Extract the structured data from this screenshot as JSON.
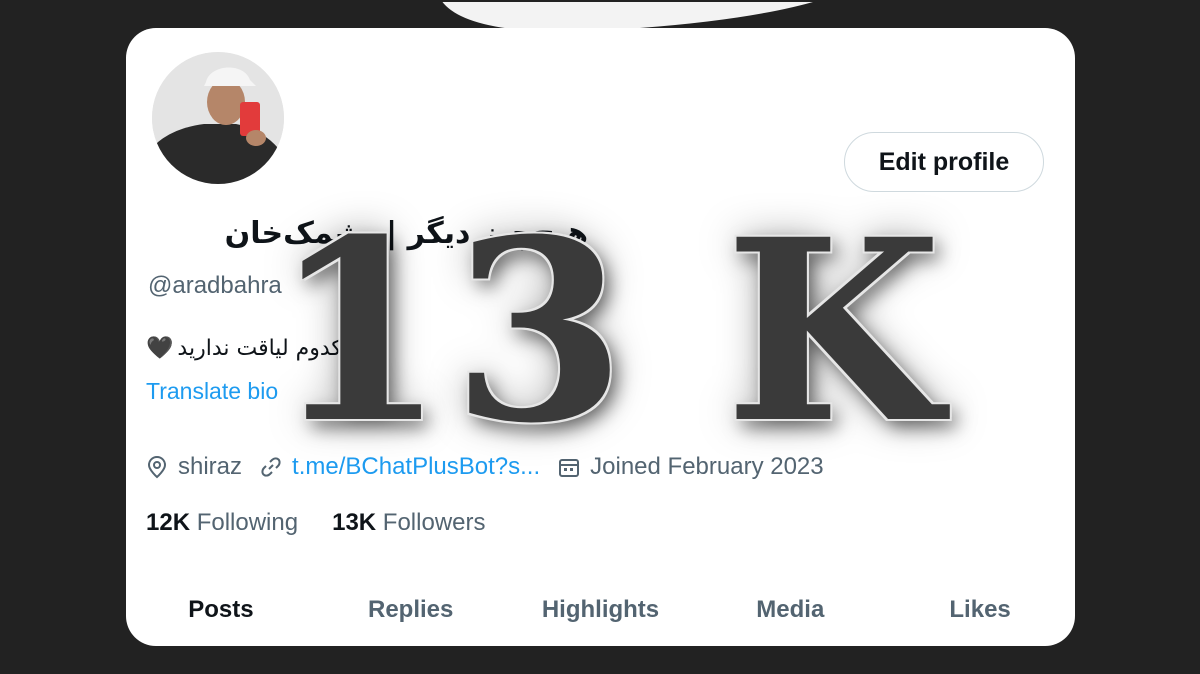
{
  "profile": {
    "display_name": "هیچ‌چیز دیگر | پشمک‌خان",
    "handle": "@aradbahra",
    "bio": "هیچ‌کدوم لیاقت ندارید",
    "bio_emoji": "🖤",
    "translate_label": "Translate bio",
    "edit_button_label": "Edit profile"
  },
  "meta": {
    "location": "shiraz",
    "link": "t.me/BChatPlusBot?s...",
    "joined": "Joined February 2023"
  },
  "stats": {
    "following_count": "12K",
    "following_label": "Following",
    "followers_count": "13K",
    "followers_label": "Followers"
  },
  "tabs": [
    {
      "label": "Posts",
      "active": true
    },
    {
      "label": "Replies",
      "active": false
    },
    {
      "label": "Highlights",
      "active": false
    },
    {
      "label": "Media",
      "active": false
    },
    {
      "label": "Likes",
      "active": false
    }
  ],
  "overlay": {
    "text": "13 K"
  },
  "colors": {
    "background": "#222222",
    "card": "#ffffff",
    "accent_link": "#1d9bf0",
    "text_primary": "#0f1419",
    "text_secondary": "#536471",
    "overlay_text": "#3a3a3a"
  },
  "icons": {
    "location": "location-pin-icon",
    "link": "link-icon",
    "joined": "calendar-icon"
  }
}
